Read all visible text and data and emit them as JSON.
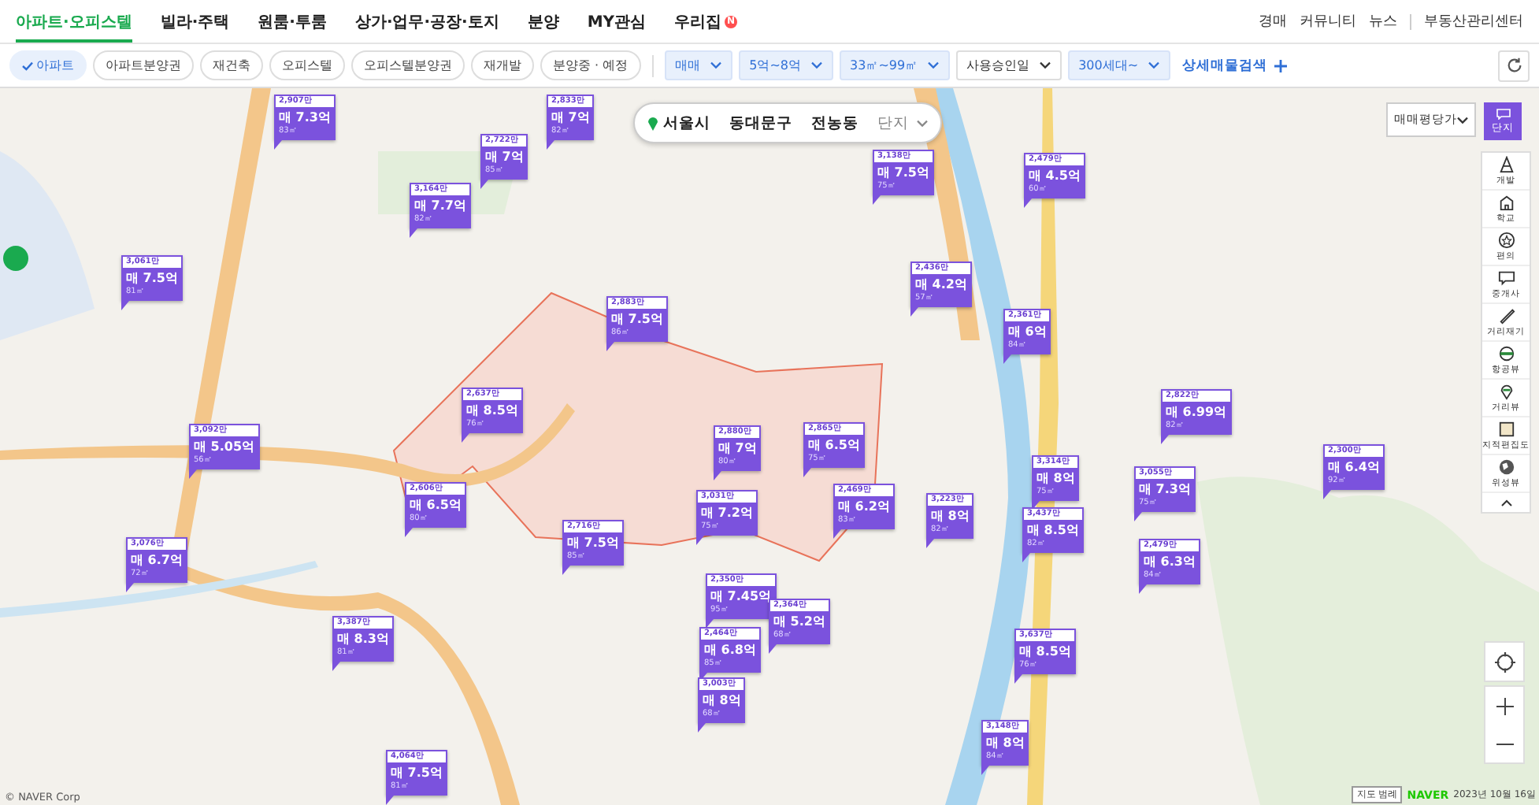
{
  "nav": {
    "tabs": [
      {
        "label": "아파트·오피스텔",
        "selected": true
      },
      {
        "label": "빌라·주택",
        "selected": false
      },
      {
        "label": "원룸·투룸",
        "selected": false
      },
      {
        "label": "상가·업무·공장·토지",
        "selected": false
      },
      {
        "label": "분양",
        "selected": false
      },
      {
        "label": "MY관심",
        "selected": false
      },
      {
        "label": "우리집",
        "selected": false,
        "badge": "N"
      }
    ],
    "links": [
      "경매",
      "커뮤니티",
      "뉴스",
      "부동산관리센터"
    ]
  },
  "filter_bar": {
    "chips": [
      {
        "label": "아파트",
        "selected": true
      },
      {
        "label": "아파트분양권",
        "selected": false
      },
      {
        "label": "재건축",
        "selected": false
      },
      {
        "label": "오피스텔",
        "selected": false
      },
      {
        "label": "오피스텔분양권",
        "selected": false
      },
      {
        "label": "재개발",
        "selected": false
      },
      {
        "label": "분양중 · 예정",
        "selected": false
      }
    ],
    "dropdowns": [
      {
        "label": "매매",
        "applied": true
      },
      {
        "label": "5억~8억",
        "applied": true
      },
      {
        "label": "33㎡~99㎡",
        "applied": true
      },
      {
        "label": "사용승인일",
        "applied": false
      },
      {
        "label": "300세대~",
        "applied": true
      }
    ],
    "detail_search": "상세매물검색"
  },
  "map": {
    "location": [
      "서울시",
      "동대문구",
      "전농동"
    ],
    "location_mode": "단지",
    "price_type": "매매평당가",
    "layer_button": "단지",
    "tools": [
      "개발",
      "학교",
      "편의",
      "중개사",
      "거리재기",
      "항공뷰",
      "거리뷰",
      "지적편집도",
      "위성뷰"
    ],
    "markers": [
      {
        "unit": "2,907만",
        "price": "매 7.3억",
        "area": "83㎡"
      },
      {
        "unit": "2,833만",
        "price": "매 7억",
        "area": "82㎡"
      },
      {
        "unit": "2,722만",
        "price": "매 7억",
        "area": "85㎡"
      },
      {
        "unit": "3,164만",
        "price": "매 7.7억",
        "area": "82㎡"
      },
      {
        "unit": "3,061만",
        "price": "매 7.5억",
        "area": "81㎡"
      },
      {
        "unit": "2,883만",
        "price": "매 7.5억",
        "area": "86㎡"
      },
      {
        "unit": "2,637만",
        "price": "매 8.5억",
        "area": "76㎡"
      },
      {
        "unit": "3,092만",
        "price": "매 5.05억",
        "area": "56㎡"
      },
      {
        "unit": "3,138만",
        "price": "매 7.5억",
        "area": "75㎡"
      },
      {
        "unit": "2,479만",
        "price": "매 4.5억",
        "area": "60㎡"
      },
      {
        "unit": "2,436만",
        "price": "매 4.2억",
        "area": "57㎡"
      },
      {
        "unit": "2,361만",
        "price": "매 6억",
        "area": "84㎡"
      },
      {
        "unit": "2,822만",
        "price": "매 6.99억",
        "area": "82㎡"
      },
      {
        "unit": "2,606만",
        "price": "매 6.5억",
        "area": "80㎡"
      },
      {
        "unit": "2,716만",
        "price": "매 7.5억",
        "area": "85㎡"
      },
      {
        "unit": "3,076만",
        "price": "매 6.7억",
        "area": "72㎡"
      },
      {
        "unit": "2,880만",
        "price": "매 7억",
        "area": "80㎡"
      },
      {
        "unit": "2,865만",
        "price": "매 6.5억",
        "area": "75㎡"
      },
      {
        "unit": "3,031만",
        "price": "매 7.2억",
        "area": "75㎡"
      },
      {
        "unit": "2,469만",
        "price": "매 6.2억",
        "area": "83㎡"
      },
      {
        "unit": "3,223만",
        "price": "매 8억",
        "area": "82㎡"
      },
      {
        "unit": "3,314만",
        "price": "매 8억",
        "area": "75㎡"
      },
      {
        "unit": "3,437만",
        "price": "매 8.5억",
        "area": "82㎡"
      },
      {
        "unit": "3,055만",
        "price": "매 7.3억",
        "area": "75㎡"
      },
      {
        "unit": "2,479만",
        "price": "매 6.3억",
        "area": "84㎡"
      },
      {
        "unit": "2,300만",
        "price": "매 6.4억",
        "area": "92㎡"
      },
      {
        "unit": "2,350만",
        "price": "매 7.45억",
        "area": "95㎡"
      },
      {
        "unit": "3,387만",
        "price": "매 8.3억",
        "area": "81㎡"
      },
      {
        "unit": "2,364만",
        "price": "매 5.2억",
        "area": "68㎡"
      },
      {
        "unit": "2,464만",
        "price": "매 6.8억",
        "area": "85㎡"
      },
      {
        "unit": "3,003만",
        "price": "매 8억",
        "area": "68㎡"
      },
      {
        "unit": "3,637만",
        "price": "매 8.5억",
        "area": "76㎡"
      },
      {
        "unit": "3,148만",
        "price": "매 8억",
        "area": "84㎡"
      },
      {
        "unit": "4,064만",
        "price": "매 7.5억",
        "area": "81㎡"
      }
    ],
    "copyright": "© NAVER Corp",
    "legend": "지도 범례",
    "brand": "NAVER",
    "date": "2023년 10월 16일"
  }
}
